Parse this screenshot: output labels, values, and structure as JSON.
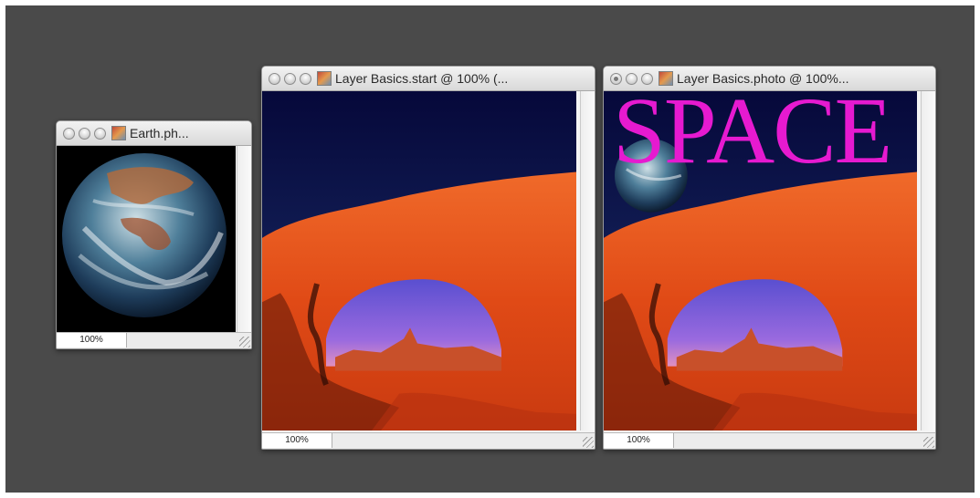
{
  "windows": [
    {
      "title": "Earth.ph...",
      "zoom": "100%"
    },
    {
      "title": "Layer Basics.start @ 100% (...",
      "zoom": "100%"
    },
    {
      "title": "Layer Basics.photo @ 100%...",
      "zoom": "100%"
    }
  ],
  "overlay_text": "SPACE",
  "colors": {
    "desktop": "#4a4a4a",
    "overlay_text": "#e61ad0",
    "sky": "#0d0f3a",
    "rock": "#e3501c"
  },
  "icons": [
    "close-button-icon",
    "minimize-button-icon",
    "zoom-button-icon",
    "document-icon",
    "resize-grip-icon"
  ]
}
